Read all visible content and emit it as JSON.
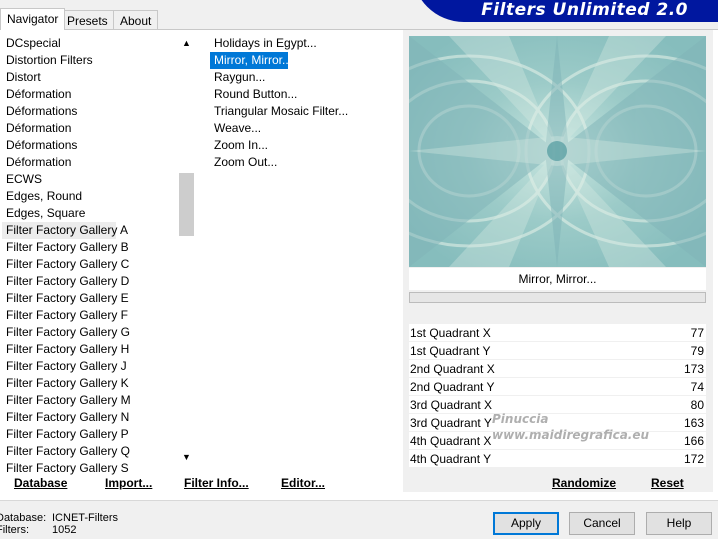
{
  "tabs": [
    "Navigator",
    "Presets",
    "About"
  ],
  "banner": {
    "title": "Filters Unlimited 2.0"
  },
  "categories": [
    "DCspecial",
    "Distortion Filters",
    "Distort",
    "Déformation",
    "Déformations",
    "Déformation",
    "Déformations",
    "Déformation",
    "ECWS",
    "Edges, Round",
    "Edges, Square",
    "Filter Factory Gallery A",
    "Filter Factory Gallery B",
    "Filter Factory Gallery C",
    "Filter Factory Gallery D",
    "Filter Factory Gallery E",
    "Filter Factory Gallery F",
    "Filter Factory Gallery G",
    "Filter Factory Gallery H",
    "Filter Factory Gallery J",
    "Filter Factory Gallery K",
    "Filter Factory Gallery M",
    "Filter Factory Gallery N",
    "Filter Factory Gallery P",
    "Filter Factory Gallery Q",
    "Filter Factory Gallery S"
  ],
  "selected_category": "Filter Factory Gallery A",
  "filters": [
    "Holidays in Egypt...",
    "Mirror, Mirror...",
    "Raygun...",
    "Round Button...",
    "Triangular Mosaic Filter...",
    "Weave...",
    "Zoom In...",
    "Zoom Out..."
  ],
  "selected_filter": "Mirror, Mirror...",
  "preview": {
    "name": "Mirror, Mirror..."
  },
  "parameters": [
    {
      "label": "1st Quadrant X",
      "value": "77"
    },
    {
      "label": "1st Quadrant Y",
      "value": "79"
    },
    {
      "label": "2nd Quadrant X",
      "value": "173"
    },
    {
      "label": "2nd Quadrant Y",
      "value": "74"
    },
    {
      "label": "3rd Quadrant X",
      "value": "80"
    },
    {
      "label": "3rd Quadrant Y",
      "value": "163"
    },
    {
      "label": "4th Quadrant X",
      "value": "166"
    },
    {
      "label": "4th Quadrant Y",
      "value": "172"
    }
  ],
  "watermark": {
    "line1": "Pinuccia",
    "line2": "www.maidiregrafica.eu"
  },
  "links": {
    "database": "Database",
    "import": "Import...",
    "filter_info": "Filter Info...",
    "editor": "Editor...",
    "randomize": "Randomize",
    "reset": "Reset"
  },
  "status": {
    "database_label": "Database:",
    "database_value": "ICNET-Filters",
    "filters_label": "Filters:",
    "filters_value": "1052"
  },
  "buttons": {
    "apply": "Apply",
    "cancel": "Cancel",
    "help": "Help"
  },
  "colors": {
    "banner": "#00179f",
    "selection": "#0078d7",
    "preview_base": "#a7d3d0"
  },
  "icons": {
    "scroll_up": "▲",
    "scroll_down": "▼"
  }
}
